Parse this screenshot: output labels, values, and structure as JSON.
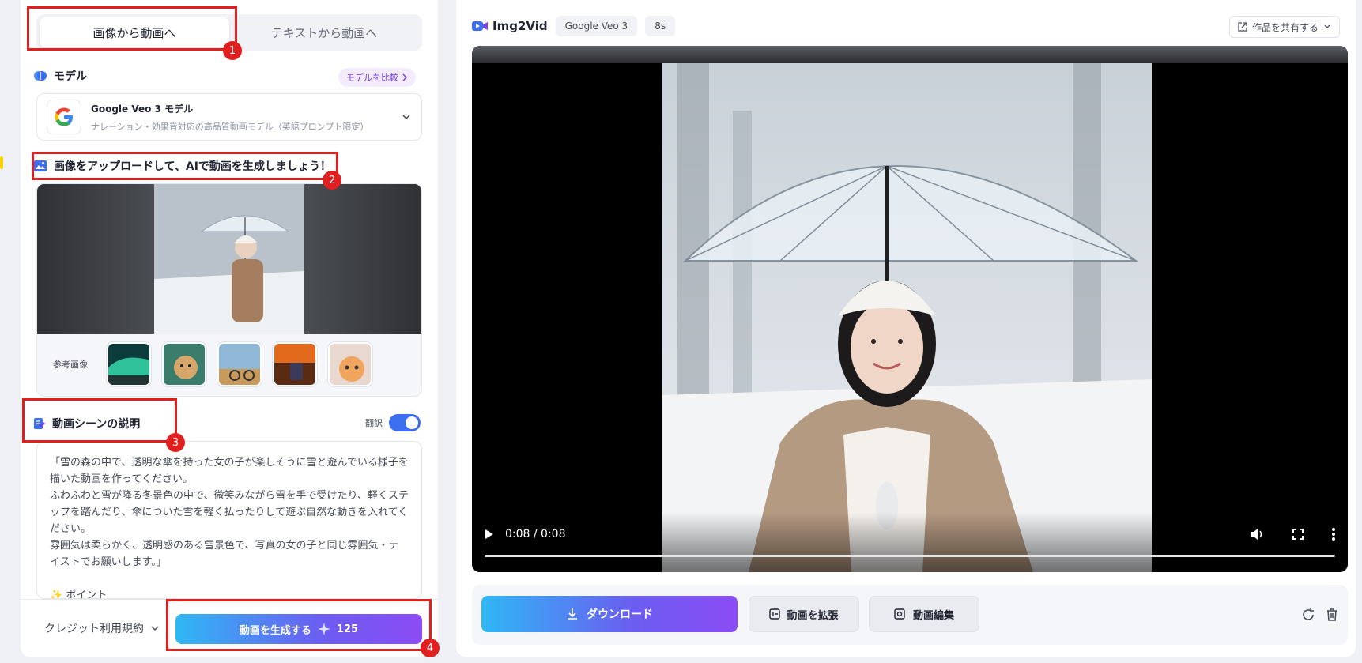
{
  "left": {
    "tabs": [
      {
        "label": "画像から動画へ",
        "active": true
      },
      {
        "label": "テキストから動画へ",
        "active": false
      }
    ],
    "model_section_title": "モデル",
    "compare_button": "モデルを比較",
    "model": {
      "name": "Google Veo 3 モデル",
      "description": "ナレーション・効果音対応の高品質動画モデル（英語プロンプト限定）"
    },
    "upload_title": "画像をアップロードして、AIで動画を生成しましょう！",
    "reference_label": "参考画像",
    "scene_title": "動画シーンの説明",
    "translate_label": "翻訳",
    "prompt_text": "「雪の森の中で、透明な傘を持った女の子が楽しそうに雪と遊んでいる様子を描いた動画を作ってください。\nふわふわと雪が降る冬景色の中で、微笑みながら雪を手で受けたり、軽くステップを踏んだり、傘についた雪を軽く払ったりして遊ぶ自然な動きを入れてください。\n雰囲気は柔らかく、透明感のある雪景色で、写真の女の子と同じ雰囲気・テイストでお願いします。」\n\n✨ ポイント",
    "terms_label": "クレジット利用規約",
    "generate_button": "動画を生成する",
    "generate_cost": "125",
    "annotations": [
      "1",
      "2",
      "3",
      "4"
    ]
  },
  "right": {
    "app_name": "Img2Vid",
    "model_pill": "Google Veo 3",
    "duration_pill": "8s",
    "share_button": "作品を共有する",
    "video_time": "0:08 / 0:08",
    "download_button": "ダウンロード",
    "extend_button": "動画を拡張",
    "edit_button": "動画編集"
  },
  "colors": {
    "accent_start": "#2fb8f5",
    "accent_end": "#8b4cf5",
    "annotation_red": "#e21f1f",
    "toggle_on": "#3b6ff0"
  }
}
